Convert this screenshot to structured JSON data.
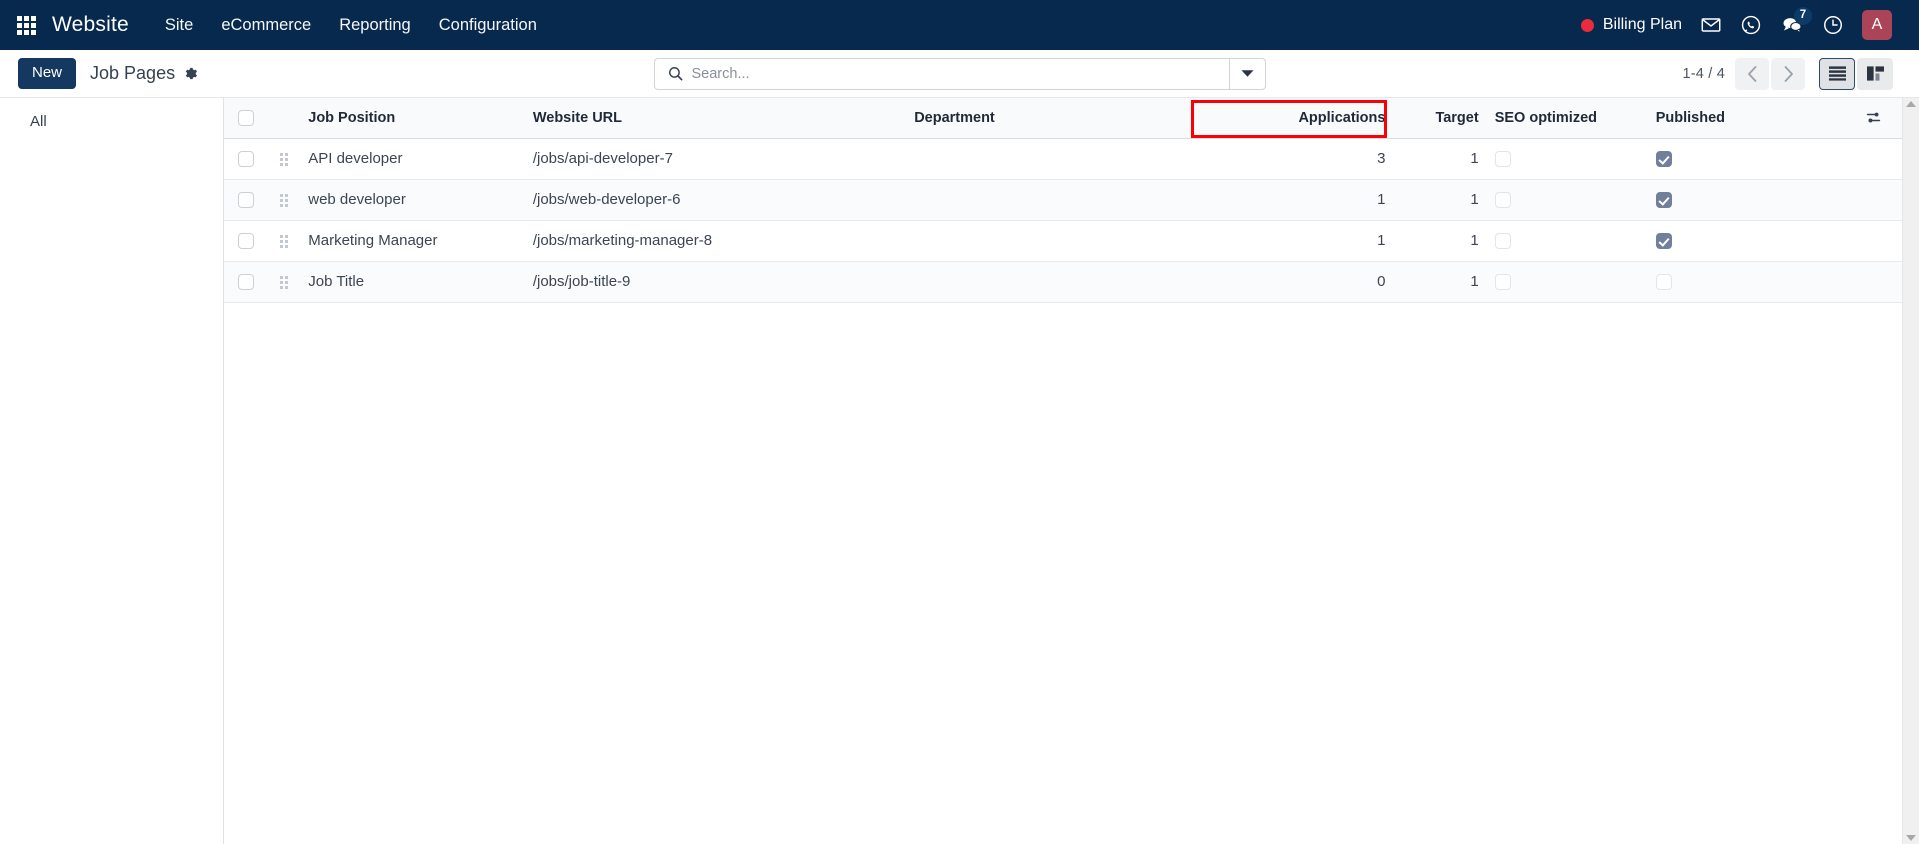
{
  "navbar": {
    "apps_icon": "grid-apps-icon",
    "brand": "Website",
    "menus": [
      {
        "label": "Site"
      },
      {
        "label": "eCommerce"
      },
      {
        "label": "Reporting"
      },
      {
        "label": "Configuration"
      }
    ],
    "billing": {
      "label": "Billing Plan",
      "dot_color": "#ea2b3c"
    },
    "icons": [
      {
        "name": "mail-icon"
      },
      {
        "name": "whatsapp-icon"
      },
      {
        "name": "messages-icon",
        "badge": "7"
      },
      {
        "name": "activity-clock-icon"
      }
    ],
    "avatar": {
      "initial": "A",
      "color": "#ab4458"
    },
    "background": "#07294d"
  },
  "control_panel": {
    "new_button": "New",
    "breadcrumb": "Job Pages",
    "settings_icon": "gear-icon",
    "search": {
      "placeholder": "Search...",
      "value": "",
      "icon": "search-icon",
      "dropdown_icon": "caret-down-icon"
    },
    "pager": {
      "range": "1-4 / 4",
      "previous_icon": "chevron-left-icon",
      "next_icon": "chevron-right-icon"
    },
    "views": [
      {
        "name": "list-view",
        "icon": "list-icon",
        "active": true
      },
      {
        "name": "kanban-view",
        "icon": "kanban-icon",
        "active": false
      }
    ]
  },
  "sidebar": {
    "items": [
      {
        "label": "All"
      }
    ]
  },
  "list": {
    "select_all_checked": false,
    "optional_columns_icon": "sliders-icon",
    "highlight_column": "Applications",
    "highlight_color": "#fb0007",
    "columns": [
      {
        "key": "position",
        "label": "Job Position"
      },
      {
        "key": "url",
        "label": "Website URL"
      },
      {
        "key": "dept",
        "label": "Department"
      },
      {
        "key": "apps",
        "label": "Applications"
      },
      {
        "key": "target",
        "label": "Target"
      },
      {
        "key": "seo",
        "label": "SEO optimized"
      },
      {
        "key": "published",
        "label": "Published"
      }
    ],
    "rows": [
      {
        "selected": false,
        "position": "API developer",
        "url": "/jobs/api-developer-7",
        "dept": "",
        "apps": "3",
        "target": "1",
        "seo": false,
        "published": true
      },
      {
        "selected": false,
        "position": "web developer",
        "url": "/jobs/web-developer-6",
        "dept": "",
        "apps": "1",
        "target": "1",
        "seo": false,
        "published": true
      },
      {
        "selected": false,
        "position": "Marketing Manager",
        "url": "/jobs/marketing-manager-8",
        "dept": "",
        "apps": "1",
        "target": "1",
        "seo": false,
        "published": true
      },
      {
        "selected": false,
        "position": "Job Title",
        "url": "/jobs/job-title-9",
        "dept": "",
        "apps": "0",
        "target": "1",
        "seo": false,
        "published": false
      }
    ]
  },
  "scrollbar": {
    "up_icon": "scroll-up-arrow-icon",
    "down_icon": "scroll-down-arrow-icon"
  }
}
